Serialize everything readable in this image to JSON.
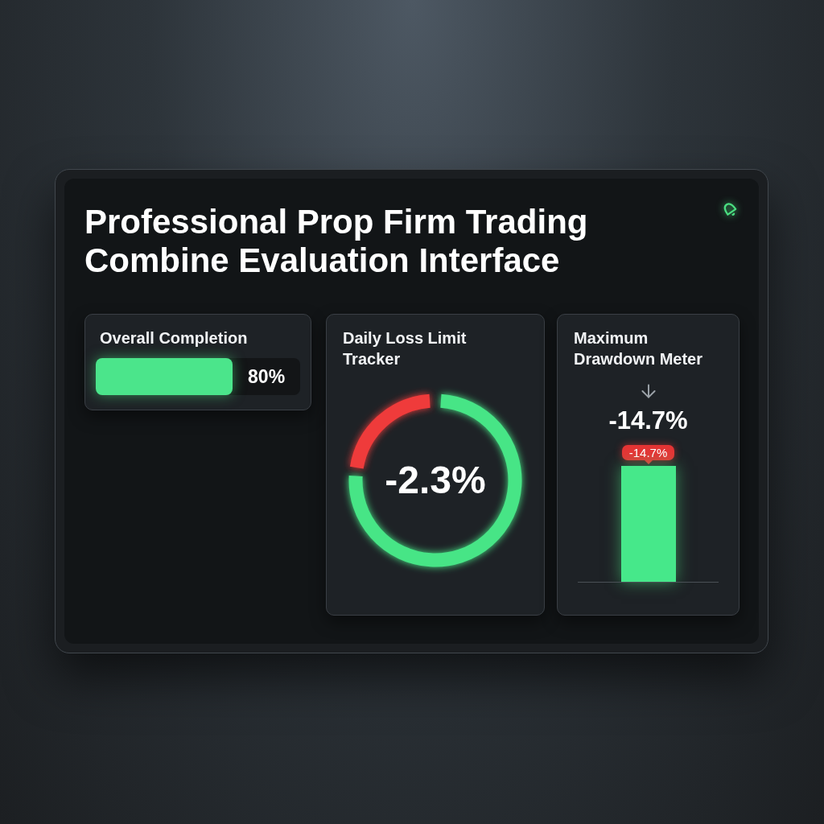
{
  "window": {
    "title": "Professional Prop Firm Trading Combine Evaluation Interface"
  },
  "cards": [
    {
      "kind": "progress",
      "title": "Overall Completion",
      "level": 0.67,
      "reading": "80%"
    },
    {
      "kind": "gauge",
      "title": "Daily Loss Limit Tracker",
      "level": 0.23,
      "reading": "-2.3%"
    },
    {
      "kind": "bar_meter",
      "title": "Maximum Drawdown Meter",
      "reading": "-14.7%",
      "badge": "-14.7%"
    }
  ]
}
